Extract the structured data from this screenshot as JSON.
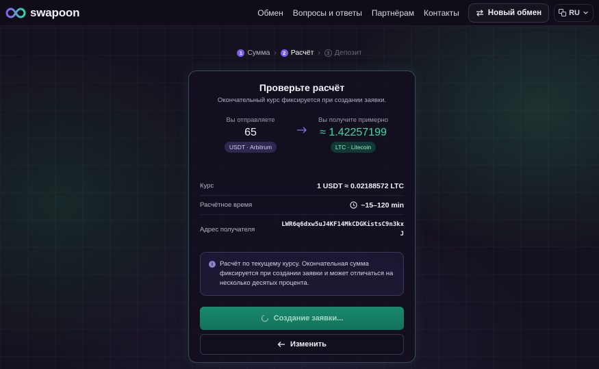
{
  "header": {
    "brand": "swapoon",
    "nav": [
      "Обмен",
      "Вопросы и ответы",
      "Партнёрам",
      "Контакты"
    ],
    "new_exchange": "Новый обмен",
    "lang": "RU"
  },
  "stepper": [
    {
      "num": "1",
      "label": "Сумма",
      "state": "done"
    },
    {
      "num": "2",
      "label": "Расчёт",
      "state": "active"
    },
    {
      "num": "3",
      "label": "Депозит",
      "state": "todo"
    }
  ],
  "card": {
    "title": "Проверьте расчёт",
    "subtitle": "Окончательный курс фиксируется при создании заявки.",
    "send": {
      "label": "Вы отправляете",
      "amount": "65",
      "asset": "USDT · Arbitrum"
    },
    "receive": {
      "label": "Вы получите примерно",
      "amount": "≈ 1.42257199",
      "asset": "LTC · Litecoin"
    },
    "rate": {
      "label": "Курс",
      "value": "1 USDT ≈ 0.02188572 LTC"
    },
    "time": {
      "label": "Расчётное время",
      "value": "~15–120 min"
    },
    "address": {
      "label": "Адрес получателя",
      "value": "LWR6q6dxw5uJ4KF14MkCDGKistsC9n3kxJ"
    },
    "info": "Расчёт по текущему курсу. Окончательная сумма фиксируется при создании заявки и может отличаться на несколько десятых процента.",
    "primary_button": "Создание заявки...",
    "secondary_button": "Изменить"
  },
  "colors": {
    "accent": "#7a5cf0",
    "success": "#3fd9a2",
    "primary_button": "#1b8a6c"
  },
  "icons": {
    "logo": "infinity-logo-icon",
    "swap": "swap-arrows-icon",
    "language": "translate-icon",
    "chevron": "chevron-down-icon",
    "arrow": "arrow-right-icon",
    "clock": "clock-icon",
    "info": "info-icon",
    "spinner": "spinner-icon",
    "back": "arrow-left-icon"
  }
}
